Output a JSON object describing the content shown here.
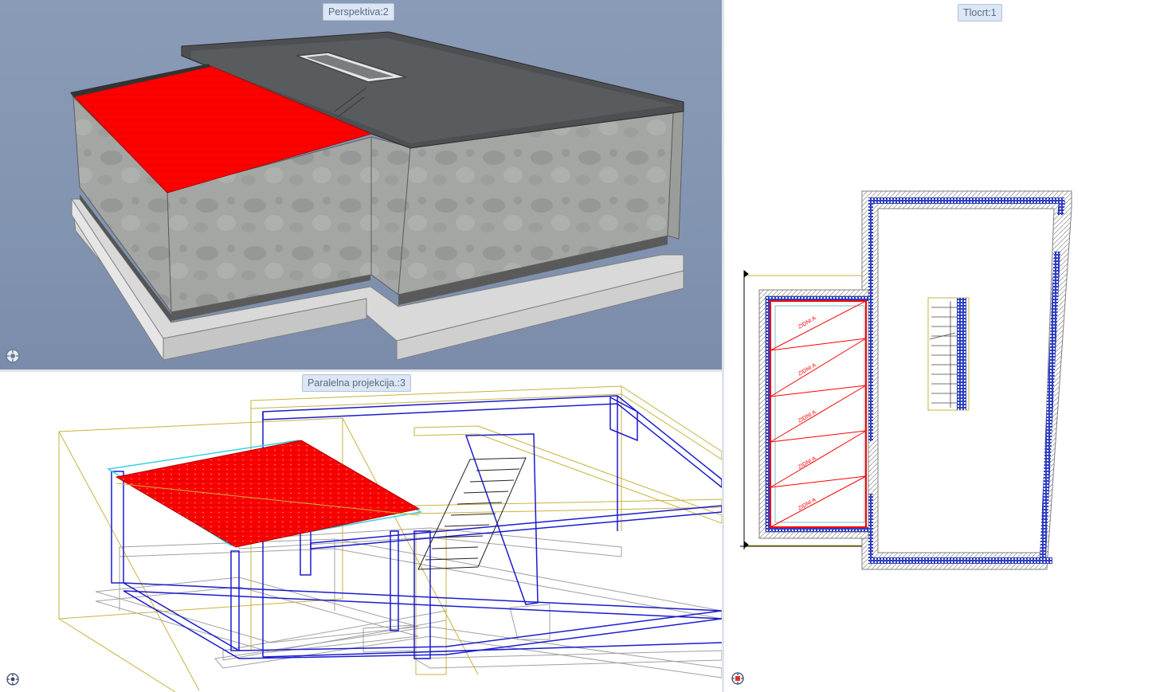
{
  "views": {
    "perspective": {
      "title": "Perspektiva:2"
    },
    "parallel": {
      "title": "Paralelna projekcija.:3"
    },
    "plan": {
      "title": "Tlocrt:1"
    }
  },
  "plan": {
    "room_labels": [
      "ZIDNI A",
      "ZIDNI A",
      "ZIDNI A",
      "ZIDNI A",
      "ZIDNI A"
    ]
  },
  "icons": {
    "navigation": "navigation-wheel-icon"
  },
  "colors": {
    "roof_highlight": "#ff0000",
    "plan_wall": "#2f3fbf",
    "wireframe_blue": "#1b1bd0",
    "wireframe_olive": "#c8b44a",
    "wireframe_cyan": "#38d0e8",
    "wireframe_grey": "#9a9a9a"
  }
}
